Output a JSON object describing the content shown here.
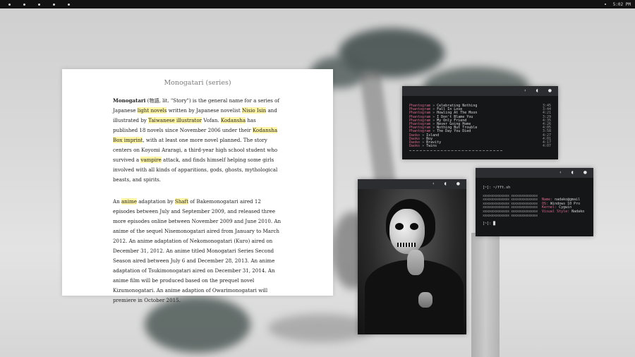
{
  "topbar": {
    "workspaces": [
      "1",
      "2",
      "3",
      "4",
      "5"
    ],
    "clock": "5:02 PM"
  },
  "article": {
    "title": "Monogatari (series)",
    "paragraphs": [
      [
        {
          "t": "Monogatari",
          "b": true
        },
        {
          "t": " (物語, lit. \"Story\") is the general name for a series of Japanese "
        },
        {
          "t": "light novels",
          "hl": true
        },
        {
          "t": " written by Japanese novelist "
        },
        {
          "t": "Nisio Isin",
          "hl": true
        },
        {
          "t": " and illustrated by "
        },
        {
          "t": "Taiwanese illustrator",
          "hl": true
        },
        {
          "t": " Vofan. "
        },
        {
          "t": "Kodansha",
          "hl": true
        },
        {
          "t": " has published 18 novels since November 2006 under their "
        },
        {
          "t": "Kodansha Box imprint",
          "hl": true
        },
        {
          "t": ", with at least one more novel planned. The story centers on Koyomi Araragi, a third-year high school student who survived a "
        },
        {
          "t": "vampire",
          "hl": true
        },
        {
          "t": " attack, and finds himself helping some girls involved with all kinds of apparitions, gods, ghosts, mythological beasts, and spirits."
        }
      ],
      [
        {
          "t": "An "
        },
        {
          "t": "anime",
          "hl": true
        },
        {
          "t": " adaptation by "
        },
        {
          "t": "Shaft",
          "hl": true
        },
        {
          "t": " of Bakemonogatari aired 12 episodes between July and September 2009, and released three more episodes online between November 2009 and June 2010. An anime of the sequel Nisemonogatari aired from January to March 2012. An anime adaptation of Nekomonogatari (Kuro) aired on December 31, 2012. An anime titled Monogatari Series Second Season aired between July 6 and December 28, 2013. An anime adaptation of Tsukimonogatari aired on December 31, 2014. An anime film will be produced based on the prequel novel Kizumonogatari. An anime adaption of Owarimonogatari will premiere in October 2015."
        }
      ]
    ]
  },
  "window_controls": {
    "back": "‹",
    "minimize": "◖",
    "close": "●"
  },
  "music": {
    "tracks": [
      {
        "artist": "Phantogram",
        "sep": " » ",
        "title": "Celebrating Nothing",
        "duration": "3:45"
      },
      {
        "artist": "Phantogram",
        "sep": " » ",
        "title": "Fall In Love",
        "duration": "3:44"
      },
      {
        "artist": "Phantogram",
        "sep": " » ",
        "title": "Howling At The Moon",
        "duration": "4:21"
      },
      {
        "artist": "Phantogram",
        "sep": " » ",
        "title": "I Don't Blame You",
        "duration": "3:29"
      },
      {
        "artist": "Phantogram",
        "sep": " » ",
        "title": "My Only Friend",
        "duration": "4:35"
      },
      {
        "artist": "Phantogram",
        "sep": " » ",
        "title": "Never Going Home",
        "duration": "4:26"
      },
      {
        "artist": "Phantogram",
        "sep": " » ",
        "title": "Nothing But Trouble",
        "duration": "4:05"
      },
      {
        "artist": "Phantogram",
        "sep": " » ",
        "title": "The Day You Died",
        "duration": "3:58"
      },
      {
        "artist": "Daoko",
        "sep": " » ",
        "title": "Island",
        "duration": "4:27"
      },
      {
        "artist": "Daoko",
        "sep": " » ",
        "title": "Boy",
        "duration": "4:01"
      },
      {
        "artist": "Daoko",
        "sep": " » ",
        "title": "Bravity",
        "duration": "4:17"
      },
      {
        "artist": "Daoko",
        "sep": " » ",
        "title": "Twins",
        "duration": "4:07"
      }
    ]
  },
  "neofetch": {
    "command": "[~]: ~/fft.sh",
    "art": "xxxxxxxxxxxxxxx xxxxxxxxxxxxxxx",
    "info": [
      {
        "k": "Name: ",
        "v": "nadako@gmail"
      },
      {
        "k": "OS: ",
        "v": "Windows 10 Pro"
      },
      {
        "k": "Kernel: ",
        "v": "Cygwin"
      },
      {
        "k": "Visual Style: ",
        "v": "Nadako"
      }
    ],
    "art_rows": 6,
    "prompt": "[~]: █"
  },
  "colors": {
    "accent_pink": "#d86a8a",
    "highlight": "#fdf4a6",
    "terminal_bg": "#151618",
    "titlebar_bg": "#2b2d31"
  }
}
